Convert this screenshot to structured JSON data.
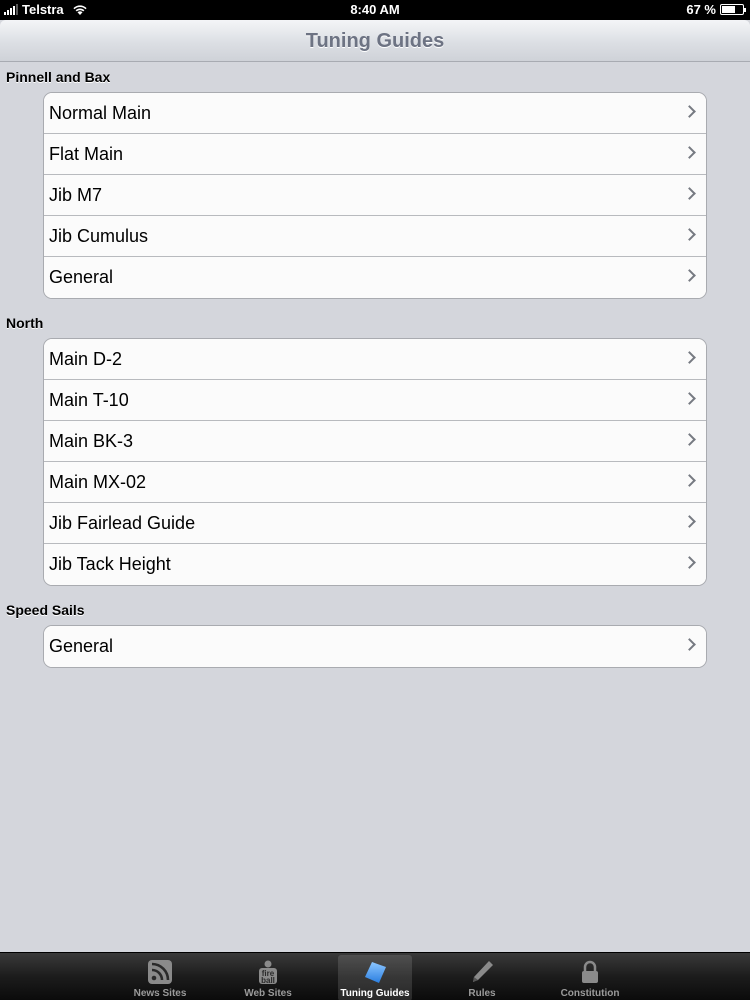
{
  "status": {
    "carrier": "Telstra",
    "time": "8:40 AM",
    "battery": "67 %",
    "battery_level": 0.67
  },
  "nav": {
    "title": "Tuning Guides"
  },
  "sections": [
    {
      "header": "Pinnell and Bax",
      "items": [
        "Normal Main",
        "Flat Main",
        "Jib M7",
        "Jib Cumulus",
        "General"
      ]
    },
    {
      "header": "North",
      "items": [
        "Main D-2",
        "Main T-10",
        "Main BK-3",
        "Main MX-02",
        "Jib Fairlead Guide",
        "Jib Tack Height"
      ]
    },
    {
      "header": "Speed Sails",
      "items": [
        "General"
      ]
    }
  ],
  "tabs": [
    {
      "label": "News Sites",
      "icon": "rss-icon"
    },
    {
      "label": "Web Sites",
      "icon": "fireball-icon"
    },
    {
      "label": "Tuning Guides",
      "icon": "sail-icon",
      "active": true
    },
    {
      "label": "Rules",
      "icon": "pencil-icon"
    },
    {
      "label": "Constitution",
      "icon": "lock-icon"
    }
  ],
  "colors": {
    "background": "#d4d6dc",
    "nav_title": "#6d7383",
    "tab_active_icon": "#4a9ae8"
  }
}
